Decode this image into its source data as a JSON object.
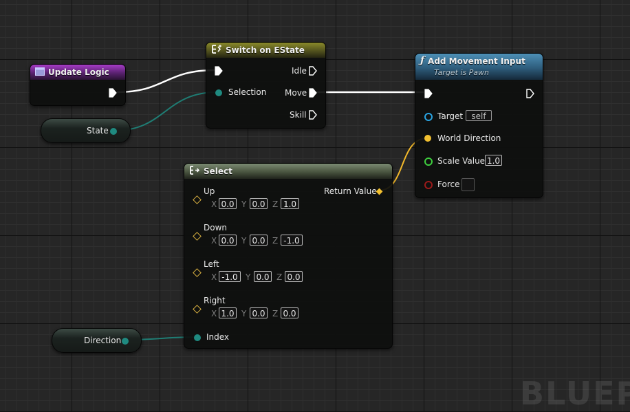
{
  "nodes": {
    "update_logic": {
      "title": "Update Logic"
    },
    "state_var": {
      "label": "State"
    },
    "switch": {
      "title": "Switch on EState",
      "selection": "Selection",
      "outputs": [
        "Idle",
        "Move",
        "Skill"
      ]
    },
    "add_movement": {
      "title": "Add Movement Input",
      "subtitle": "Target is Pawn",
      "target": {
        "label": "Target",
        "value": "self"
      },
      "world_direction": "World Direction",
      "scale": {
        "label": "Scale Value",
        "value": "1.0"
      },
      "force": "Force"
    },
    "select": {
      "title": "Select",
      "return_value": "Return Value",
      "axis_labels": [
        "X",
        "Y",
        "Z"
      ],
      "options": [
        {
          "label": "Up",
          "x": "0.0",
          "y": "0.0",
          "z": "1.0"
        },
        {
          "label": "Down",
          "x": "0.0",
          "y": "0.0",
          "z": "-1.0"
        },
        {
          "label": "Left",
          "x": "-1.0",
          "y": "0.0",
          "z": "0.0"
        },
        {
          "label": "Right",
          "x": "1.0",
          "y": "0.0",
          "z": "0.0"
        }
      ],
      "index": "Index"
    },
    "direction_var": {
      "label": "Direction"
    }
  },
  "watermark": "BLUEP",
  "colors": {
    "exec": "#ffffff",
    "enum_pin": "#1f8a80",
    "vector_pin": "#f2c030",
    "object_pin": "#2aa3e0",
    "float_pin": "#3fcf3f",
    "bool_pin": "#9b1a1a",
    "wildcard_pin": "#d8b040"
  }
}
